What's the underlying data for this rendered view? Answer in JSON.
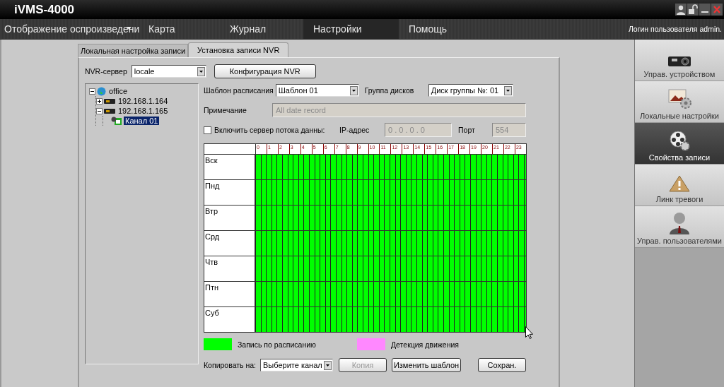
{
  "window": {
    "title": "iVMS-4000"
  },
  "menu": {
    "items": [
      {
        "label": "Отображение оспроизведени",
        "selected": false,
        "dropdown": true
      },
      {
        "label": "Карта",
        "selected": false,
        "dropdown": false
      },
      {
        "label": "Журнал",
        "selected": false,
        "dropdown": false
      },
      {
        "label": "Настройки",
        "selected": true,
        "dropdown": false
      },
      {
        "label": "Помощь",
        "selected": false,
        "dropdown": false
      }
    ],
    "login": "Логин пользователя admin."
  },
  "tabs": [
    {
      "label": "Локальная настройка записи",
      "selected": false
    },
    {
      "label": "Установка записи NVR",
      "selected": true
    }
  ],
  "nvr_server": {
    "label": "NVR-сервер",
    "value": "locale"
  },
  "config_button": "Конфигурация NVR",
  "tree": [
    {
      "label": "office",
      "kind": "site",
      "expanded": true,
      "selected": false,
      "children": [
        {
          "label": "192.168.1.164",
          "kind": "device",
          "expanded": false,
          "selected": false
        },
        {
          "label": "192.168.1.165",
          "kind": "device",
          "expanded": true,
          "selected": false,
          "children": [
            {
              "label": "Канал 01",
              "kind": "camera",
              "selected": true
            }
          ]
        }
      ]
    }
  ],
  "form": {
    "template": {
      "label": "Шаблон расписания",
      "value": "Шаблон 01"
    },
    "disk_group": {
      "label": "Группа дисков",
      "value": "Диск группы №: 01"
    },
    "note": {
      "label": "Примечание",
      "value": "All date record",
      "disabled": true
    },
    "stream_server": {
      "label": "Включить сервер потока данны:",
      "checked": false
    },
    "ip": {
      "label": "IP-адрес",
      "value": "0 . 0 . 0 . 0",
      "disabled": true
    },
    "port": {
      "label": "Порт",
      "value": "554",
      "disabled": true
    }
  },
  "schedule": {
    "hours": [
      "0",
      "1",
      "2",
      "3",
      "4",
      "5",
      "6",
      "7",
      "8",
      "9",
      "10",
      "11",
      "12",
      "13",
      "14",
      "15",
      "16",
      "17",
      "18",
      "19",
      "20",
      "21",
      "22",
      "23"
    ],
    "days": [
      {
        "label": "Вск",
        "color": "#00ff00"
      },
      {
        "label": "Пнд",
        "color": "#00ff00"
      },
      {
        "label": "Втр",
        "color": "#00ff00"
      },
      {
        "label": "Срд",
        "color": "#00ff00"
      },
      {
        "label": "Чтв",
        "color": "#00ff00"
      },
      {
        "label": "Птн",
        "color": "#00ff00"
      },
      {
        "label": "Суб",
        "color": "#00ff00"
      }
    ]
  },
  "legend": [
    {
      "label": "Запись по расписанию",
      "color": "#00ff00"
    },
    {
      "label": "Детекция движения",
      "color": "#ff88ff"
    }
  ],
  "copy": {
    "label": "Копировать на:",
    "value": "Выберите канал"
  },
  "buttons": [
    {
      "label": "Копия",
      "disabled": true
    },
    {
      "label": "Изменить шаблон",
      "disabled": false
    },
    {
      "label": "Сохран.",
      "disabled": false
    }
  ],
  "sidebar": [
    {
      "label": "Управ. устройством",
      "kind": "device",
      "selected": false
    },
    {
      "label": "Локальные настройки",
      "kind": "local",
      "selected": false
    },
    {
      "label": "Свойства записи",
      "kind": "record",
      "selected": true
    },
    {
      "label": "Линк тревоги",
      "kind": "alarm",
      "selected": false
    },
    {
      "label": "Управ. пользователями",
      "kind": "users",
      "selected": false
    }
  ]
}
